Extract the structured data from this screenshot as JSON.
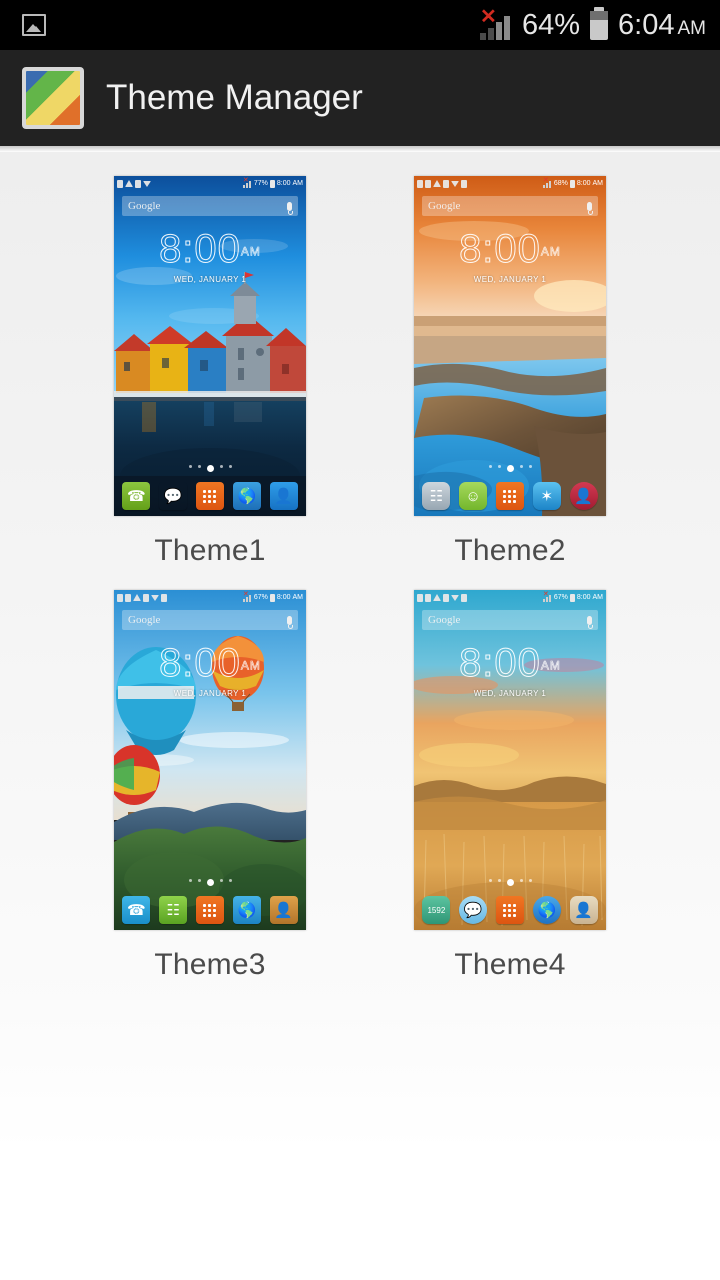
{
  "status_bar": {
    "left_icons": [
      "photo-icon"
    ],
    "signal": {
      "icon": "signal-bars-icon",
      "overlay": "x-mark",
      "overlay_color": "#d22b20"
    },
    "battery_percent": "64%",
    "battery_icon": "battery-icon",
    "time": "6:04",
    "time_period": "AM",
    "background": "#000000"
  },
  "app_bar": {
    "icon": "theme-manager-app-icon",
    "title": "Theme Manager",
    "background": "#222222",
    "title_color": "#f1f1f1"
  },
  "themes": [
    {
      "label": "Theme1",
      "wallpaper_description": "Colorful harbor houses reflected in dark blue water",
      "status": {
        "battery": "77%",
        "time": "8:00",
        "period": "AM"
      },
      "search": {
        "text": "Google",
        "mic": "microphone-icon"
      },
      "clock": {
        "time": "8:00",
        "period": "AM",
        "date": "WED, JANUARY 1"
      },
      "pages": {
        "count": 5,
        "active": 3
      },
      "dock": [
        {
          "name": "phone",
          "glyph": "✆",
          "color": "#7ab828"
        },
        {
          "name": "messages",
          "glyph": "✉",
          "color": "#f0a71a"
        },
        {
          "name": "app-drawer",
          "glyph": "grid",
          "color": "#e8631a"
        },
        {
          "name": "browser",
          "glyph": "●",
          "color": "#2d7ec1"
        },
        {
          "name": "contacts",
          "glyph": "♟",
          "color": "#1f8fe0"
        }
      ]
    },
    {
      "label": "Theme2",
      "wallpaper_description": "Rocky beach tide pools at sunset with blue sky reflection",
      "status": {
        "battery": "68%",
        "time": "8:00",
        "period": "AM"
      },
      "search": {
        "text": "Google",
        "mic": "microphone-icon"
      },
      "clock": {
        "time": "8:00",
        "period": "AM",
        "date": "WED, JANUARY 1"
      },
      "pages": {
        "count": 5,
        "active": 3
      },
      "dock": [
        {
          "name": "dialer",
          "glyph": "☰",
          "color": "#9aa8b4"
        },
        {
          "name": "messages",
          "glyph": "☺",
          "color": "#8dc63f"
        },
        {
          "name": "app-drawer",
          "glyph": "grid",
          "color": "#e8631a"
        },
        {
          "name": "browser",
          "glyph": "✵",
          "color": "#2b9ad6"
        },
        {
          "name": "contacts",
          "glyph": "♟",
          "color": "#bf2b42"
        }
      ]
    },
    {
      "label": "Theme3",
      "wallpaper_description": "Hot air balloons over green forested mountains",
      "status": {
        "battery": "67%",
        "time": "8:00",
        "period": "AM"
      },
      "search": {
        "text": "Google",
        "mic": "microphone-icon"
      },
      "clock": {
        "time": "8:00",
        "period": "AM",
        "date": "WED, JANUARY 1"
      },
      "pages": {
        "count": 5,
        "active": 3
      },
      "dock": [
        {
          "name": "phone",
          "glyph": "✆",
          "color": "#29a3dc"
        },
        {
          "name": "messages",
          "glyph": "☰",
          "color": "#6ab42c"
        },
        {
          "name": "app-drawer",
          "glyph": "grid",
          "color": "#e8631a"
        },
        {
          "name": "browser",
          "glyph": "●",
          "color": "#2a9ad6"
        },
        {
          "name": "contacts",
          "glyph": "♟",
          "color": "#c98a2c"
        }
      ]
    },
    {
      "label": "Theme4",
      "wallpaper_description": "Golden wheat field under a colorful sunset sky",
      "status": {
        "battery": "67%",
        "time": "8:00",
        "period": "AM"
      },
      "search": {
        "text": "Google",
        "mic": "microphone-icon"
      },
      "clock": {
        "time": "8:00",
        "period": "AM",
        "date": "WED, JANUARY 1"
      },
      "pages": {
        "count": 5,
        "active": 3
      },
      "dock": [
        {
          "name": "dialer",
          "glyph": "∷",
          "color": "#3fae87"
        },
        {
          "name": "messages",
          "glyph": "●",
          "color": "#7fc8ee"
        },
        {
          "name": "app-drawer",
          "glyph": "grid",
          "color": "#e8631a"
        },
        {
          "name": "browser",
          "glyph": "●",
          "color": "#2d86d8"
        },
        {
          "name": "contacts",
          "glyph": "♟",
          "color": "#d8c3a0"
        }
      ]
    }
  ]
}
